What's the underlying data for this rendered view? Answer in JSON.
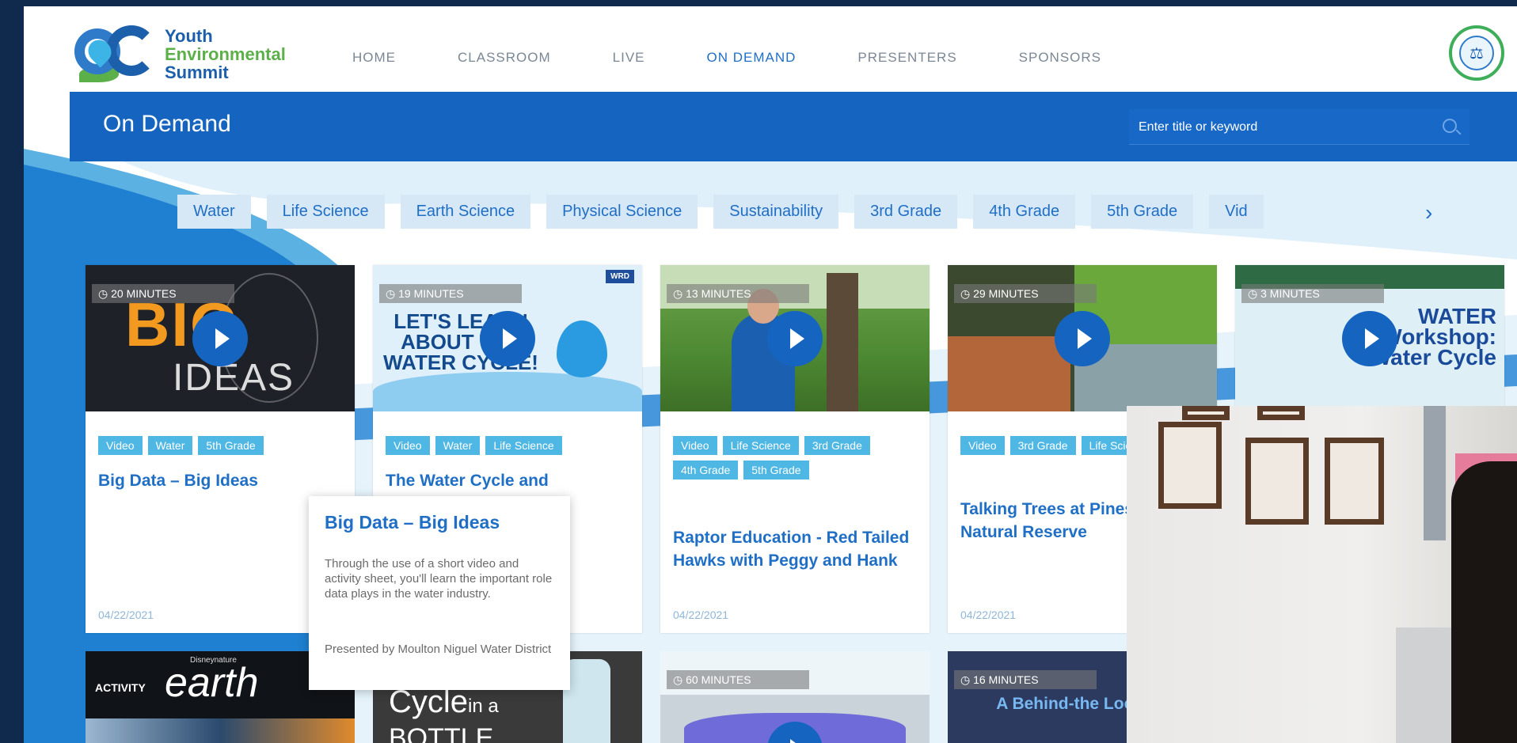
{
  "logo": {
    "line1": "Youth",
    "line2": "Environmental",
    "line3": "Summit"
  },
  "nav": [
    {
      "label": "HOME"
    },
    {
      "label": "CLASSROOM"
    },
    {
      "label": "LIVE"
    },
    {
      "label": "ON DEMAND"
    },
    {
      "label": "PRESENTERS"
    },
    {
      "label": "SPONSORS"
    }
  ],
  "page_title": "On Demand",
  "search": {
    "placeholder": "Enter title or keyword"
  },
  "filters": [
    "Water",
    "Life Science",
    "Earth Science",
    "Physical Science",
    "Sustainability",
    "3rd Grade",
    "4th Grade",
    "5th Grade",
    "Vid"
  ],
  "cards": [
    {
      "duration": "20 MINUTES",
      "tags": [
        "Video",
        "Water",
        "5th Grade"
      ],
      "title": "Big Data – Big Ideas",
      "date": "04/22/2021",
      "thumb": {
        "big": "BIG",
        "ideas": "IDEAS"
      }
    },
    {
      "duration": "19 MINUTES",
      "tags": [
        "Video",
        "Water",
        "Life Science"
      ],
      "title": "The Water Cycle and",
      "date": "",
      "thumb": {
        "text": "LET'S LEARN ABOUT THE WATER CYCLE!",
        "badge": "WRD"
      }
    },
    {
      "duration": "13 MINUTES",
      "tags": [
        "Video",
        "Life Science",
        "3rd Grade",
        "4th Grade",
        "5th Grade"
      ],
      "title": "Raptor Education - Red Tailed Hawks with Peggy and Hank",
      "date": "04/22/2021"
    },
    {
      "duration": "29 MINUTES",
      "tags": [
        "Video",
        "3rd Grade",
        "Life Science"
      ],
      "title": "Talking Trees at Pines State Natural Reserve",
      "date": "04/22/2021"
    },
    {
      "duration": "3 MINUTES",
      "tags": [],
      "title": "",
      "date": "",
      "thumb": {
        "text": "WATER Workshop: Water Cycle"
      }
    }
  ],
  "tooltip": {
    "title": "Big Data – Big Ideas",
    "description": "Through the use of a short video and activity sheet, you'll learn the important role data plays in the water industry.",
    "presented_by": "Presented by Moulton Niguel Water District"
  },
  "row2": [
    {
      "activity": "ACTIVITY",
      "brand": "Disneynature",
      "title": "earth"
    },
    {
      "title_main": "Cycle",
      "title_small": "in a",
      "title_tail": "BOTTLE"
    },
    {
      "duration": "60 MINUTES"
    },
    {
      "duration": "16 MINUTES",
      "text": "A Behind-the Look i"
    }
  ],
  "colors": {
    "primary": "#1565c0",
    "accent": "#1f6fc6",
    "tag": "#4fb7e3",
    "chip": "#d6e7f6"
  }
}
